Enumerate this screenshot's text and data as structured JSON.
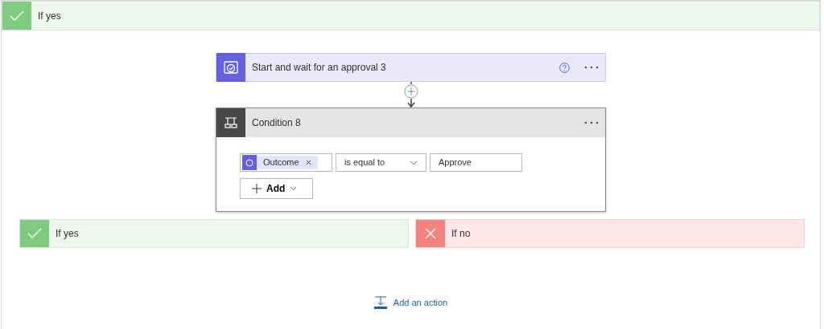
{
  "scope": {
    "kind": "yes",
    "label": "If yes"
  },
  "approval_step": {
    "title": "Start and wait for an approval 3"
  },
  "condition": {
    "title": "Condition 8",
    "token": "Outcome",
    "operator": "is equal to",
    "value": "Approve",
    "add_label": "Add"
  },
  "branches": [
    {
      "kind": "yes",
      "label": "If yes"
    },
    {
      "kind": "no",
      "label": "If no"
    }
  ],
  "add_action": "Add an action"
}
